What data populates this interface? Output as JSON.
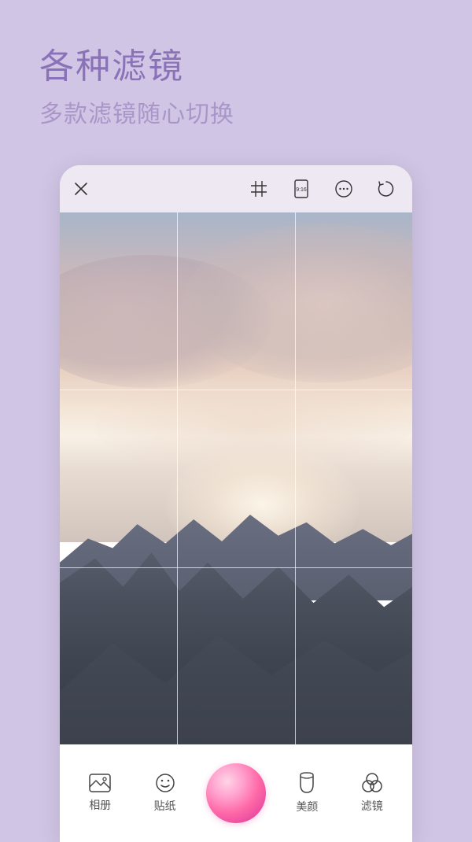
{
  "header": {
    "title": "各种滤镜",
    "subtitle": "多款滤镜随心切换"
  },
  "topbar": {
    "close_icon": "close",
    "grid_icon": "grid",
    "ratio_label": "9:16",
    "more_icon": "more",
    "switch_icon": "switch-camera"
  },
  "bottom": {
    "album": "相册",
    "sticker": "贴纸",
    "beauty": "美颜",
    "filter": "滤镜"
  }
}
